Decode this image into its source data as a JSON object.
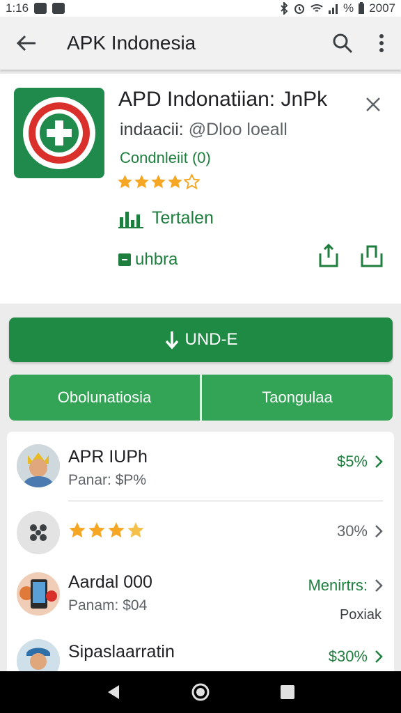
{
  "status_bar": {
    "time": "1:16",
    "right_text": "%",
    "clock_right": "2007"
  },
  "toolbar": {
    "title": "APK Indonesia",
    "back_icon": "arrow-left-icon",
    "search_icon": "search-icon",
    "more_icon": "more-vert-icon"
  },
  "app": {
    "title": "APD Indonatiian: JnPk",
    "developer": "indaacii:",
    "developer_handle": "@Dloo loeall",
    "category": "Condnleiit (0)",
    "rating": 4.5,
    "meta_label": "Tertalen",
    "tag_label": "uhbra",
    "colors": {
      "brand_green": "#1e8a44",
      "accent_green": "#33a356",
      "star": "#f5a623"
    }
  },
  "install": {
    "label": "UND-E",
    "icon": "download-arrow-icon"
  },
  "actions": {
    "left_label": "Obolunatiosia",
    "right_label": "Taongulaa"
  },
  "list": [
    {
      "title": "APR IUPh",
      "subtitle": "Panar: $P%",
      "value": "$5%",
      "value_color": "green",
      "avatar": "person-avatar-crown"
    },
    {
      "rating": 4,
      "value": "30%",
      "value_color": "gray",
      "avatar": "grid-dots-avatar"
    },
    {
      "title": "Aardal 000",
      "subtitle": "Panam: $04",
      "value": "Menirtrs:",
      "value_color": "green",
      "extra": "Poxiak",
      "avatar": "phone-avatar"
    },
    {
      "title": "Sipaslaarratin",
      "value": "$30%",
      "value_color": "green",
      "avatar": "person-avatar-cap"
    }
  ]
}
